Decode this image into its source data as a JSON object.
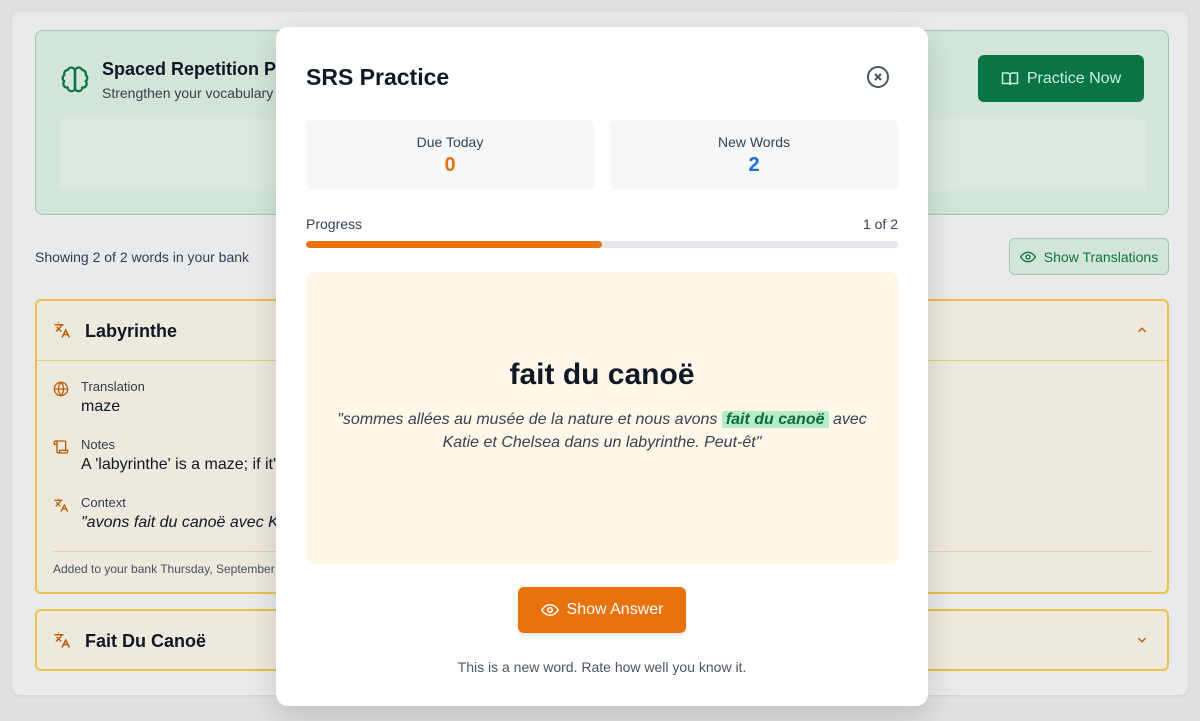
{
  "banner": {
    "title": "Spaced Repetition Pr",
    "subtitle": "Strengthen your vocabulary w",
    "practice_label": "Practice Now"
  },
  "bank": {
    "count_text": "Showing 2 of 2 words in your bank",
    "show_translations_label": "Show Translations"
  },
  "cards": [
    {
      "title": "Labyrinthe",
      "translation_label": "Translation",
      "translation_value": "maze",
      "notes_label": "Notes",
      "notes_value": "A 'labyrinthe' is a maze; if it's",
      "context_label": "Context",
      "context_value": "\"avons fait du canoë avec Ka",
      "added_note": "Added to your bank Thursday, September 1"
    },
    {
      "title": "Fait Du Canoë"
    }
  ],
  "modal": {
    "title": "SRS Practice",
    "due_label": "Due Today",
    "due_value": "0",
    "new_label": "New Words",
    "new_value": "2",
    "progress_label": "Progress",
    "progress_count": "1 of 2",
    "progress_fraction": 0.5,
    "phrase": "fait du canoë",
    "context_before": "\"sommes allées au musée de la nature et nous avons ",
    "context_highlight": "fait du canoë",
    "context_after": " avec Katie et Chelsea dans un labyrinthe. Peut-êt\"",
    "show_answer_label": "Show Answer",
    "hint": "This is a new word. Rate how well you know it."
  },
  "colors": {
    "accent_orange": "#e8720c",
    "accent_green": "#0b7a47",
    "new_words_blue": "#1d6fd8",
    "card_border": "#f2c94c"
  }
}
